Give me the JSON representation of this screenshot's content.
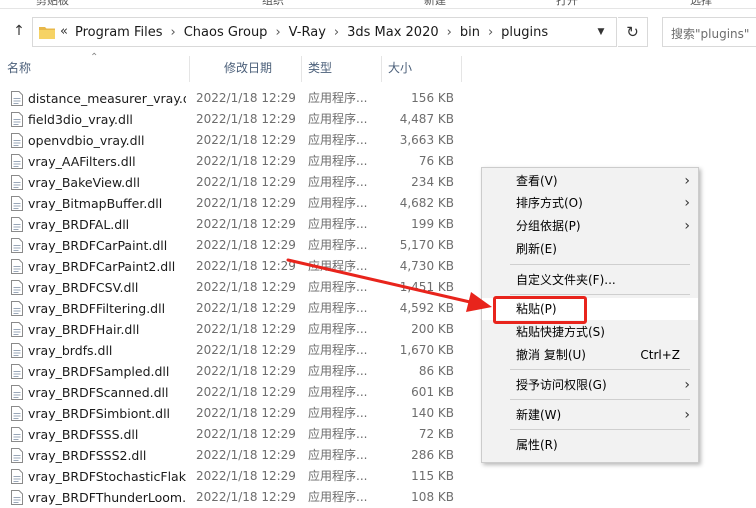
{
  "ribbon": {
    "labels": [
      "剪贴板",
      "组织",
      "新建",
      "打开",
      "选择"
    ]
  },
  "address": {
    "overflow": "«",
    "crumbs": [
      "Program Files",
      "Chaos Group",
      "V-Ray",
      "3ds Max 2020",
      "bin",
      "plugins"
    ],
    "search_placeholder": "搜索\"plugins\""
  },
  "columns": {
    "name": "名称",
    "date": "修改日期",
    "type": "类型",
    "size": "大小"
  },
  "files": [
    {
      "name": "distance_measurer_vray.dll",
      "date": "2022/1/18 12:29",
      "type": "应用程序...",
      "size": "156 KB"
    },
    {
      "name": "field3dio_vray.dll",
      "date": "2022/1/18 12:29",
      "type": "应用程序...",
      "size": "4,487 KB"
    },
    {
      "name": "openvdbio_vray.dll",
      "date": "2022/1/18 12:29",
      "type": "应用程序...",
      "size": "3,663 KB"
    },
    {
      "name": "vray_AAFilters.dll",
      "date": "2022/1/18 12:29",
      "type": "应用程序...",
      "size": "76 KB"
    },
    {
      "name": "vray_BakeView.dll",
      "date": "2022/1/18 12:29",
      "type": "应用程序...",
      "size": "234 KB"
    },
    {
      "name": "vray_BitmapBuffer.dll",
      "date": "2022/1/18 12:29",
      "type": "应用程序...",
      "size": "4,682 KB"
    },
    {
      "name": "vray_BRDFAL.dll",
      "date": "2022/1/18 12:29",
      "type": "应用程序...",
      "size": "199 KB"
    },
    {
      "name": "vray_BRDFCarPaint.dll",
      "date": "2022/1/18 12:29",
      "type": "应用程序...",
      "size": "5,170 KB"
    },
    {
      "name": "vray_BRDFCarPaint2.dll",
      "date": "2022/1/18 12:29",
      "type": "应用程序...",
      "size": "4,730 KB"
    },
    {
      "name": "vray_BRDFCSV.dll",
      "date": "2022/1/18 12:29",
      "type": "应用程序...",
      "size": "1,451 KB"
    },
    {
      "name": "vray_BRDFFiltering.dll",
      "date": "2022/1/18 12:29",
      "type": "应用程序...",
      "size": "4,592 KB"
    },
    {
      "name": "vray_BRDFHair.dll",
      "date": "2022/1/18 12:29",
      "type": "应用程序...",
      "size": "200 KB"
    },
    {
      "name": "vray_brdfs.dll",
      "date": "2022/1/18 12:29",
      "type": "应用程序...",
      "size": "1,670 KB"
    },
    {
      "name": "vray_BRDFSampled.dll",
      "date": "2022/1/18 12:29",
      "type": "应用程序...",
      "size": "86 KB"
    },
    {
      "name": "vray_BRDFScanned.dll",
      "date": "2022/1/18 12:29",
      "type": "应用程序...",
      "size": "601 KB"
    },
    {
      "name": "vray_BRDFSimbiont.dll",
      "date": "2022/1/18 12:29",
      "type": "应用程序...",
      "size": "140 KB"
    },
    {
      "name": "vray_BRDFSSS.dll",
      "date": "2022/1/18 12:29",
      "type": "应用程序...",
      "size": "72 KB"
    },
    {
      "name": "vray_BRDFSSS2.dll",
      "date": "2022/1/18 12:29",
      "type": "应用程序...",
      "size": "286 KB"
    },
    {
      "name": "vray_BRDFStochasticFlak...",
      "date": "2022/1/18 12:29",
      "type": "应用程序...",
      "size": "115 KB"
    },
    {
      "name": "vray_BRDFThunderLoom....",
      "date": "2022/1/18 12:29",
      "type": "应用程序...",
      "size": "108 KB"
    }
  ],
  "context_menu": {
    "view": "查看(V)",
    "sort": "排序方式(O)",
    "group": "分组依据(P)",
    "refresh": "刷新(E)",
    "customize": "自定义文件夹(F)...",
    "paste": "粘贴(P)",
    "paste_shortcut": "粘贴快捷方式(S)",
    "undo_copy": "撤消 复制(U)",
    "undo_shortcut": "Ctrl+Z",
    "grant_access": "授予访问权限(G)",
    "new": "新建(W)",
    "properties": "属性(R)"
  },
  "annotation_color": "#e8241c"
}
